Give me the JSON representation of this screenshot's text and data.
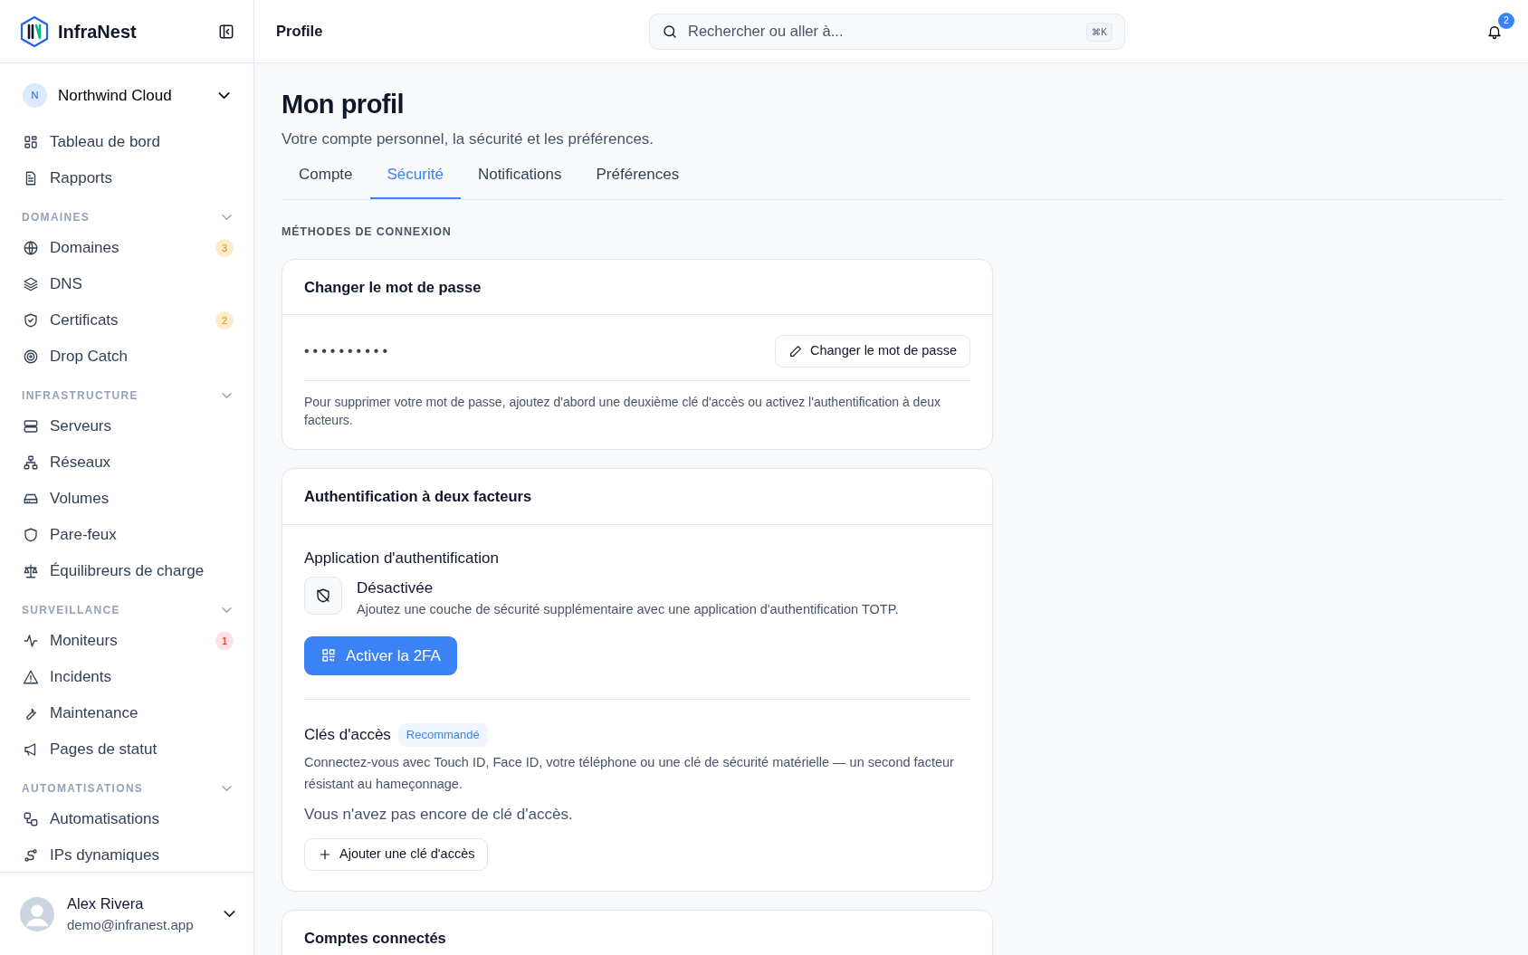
{
  "sidebar": {
    "brand": "InfraNest",
    "org": {
      "initial": "N",
      "name": "Northwind Cloud"
    },
    "top_items": [
      {
        "label": "Tableau de bord"
      },
      {
        "label": "Rapports"
      }
    ],
    "sections": [
      {
        "title": "DOMAINES",
        "items": [
          {
            "label": "Domaines",
            "badge": "3",
            "color": "#fdeccc"
          },
          {
            "label": "DNS"
          },
          {
            "label": "Certificats",
            "badge": "2",
            "color": "#fdeccc"
          },
          {
            "label": "Drop Catch"
          }
        ]
      },
      {
        "title": "INFRASTRUCTURE",
        "items": [
          {
            "label": "Serveurs"
          },
          {
            "label": "Réseaux"
          },
          {
            "label": "Volumes"
          },
          {
            "label": "Pare-feux"
          },
          {
            "label": "Équilibreurs de charge"
          }
        ]
      },
      {
        "title": "SURVEILLANCE",
        "items": [
          {
            "label": "Moniteurs",
            "badge": "1",
            "color": "#fde2e2"
          },
          {
            "label": "Incidents"
          },
          {
            "label": "Maintenance"
          },
          {
            "label": "Pages de statut"
          }
        ]
      },
      {
        "title": "AUTOMATISATIONS",
        "items": [
          {
            "label": "Automatisations"
          },
          {
            "label": "IPs dynamiques"
          }
        ]
      }
    ],
    "user": {
      "name": "Alex Rivera",
      "email": "demo@infranest.app"
    }
  },
  "header": {
    "title": "Profile",
    "search": {
      "placeholder": "Rechercher ou aller à...",
      "shortcut": "⌘K"
    },
    "notifications": "2"
  },
  "page": {
    "title": "Mon profil",
    "subtitle": "Votre compte personnel, la sécurité et les préférences.",
    "tabs": [
      {
        "label": "Compte",
        "selected": false
      },
      {
        "label": "Sécurité",
        "selected": true
      },
      {
        "label": "Notifications",
        "selected": false
      },
      {
        "label": "Préférences",
        "selected": false
      }
    ],
    "section_label": "MÉTHODES DE CONNEXION",
    "password_card": {
      "title": "Changer le mot de passe",
      "masked": "••••••••••",
      "button": "Changer le mot de passe",
      "note": "Pour supprimer votre mot de passe, ajoutez d'abord une deuxième clé d'accès ou activez l'authentification à deux facteurs."
    },
    "twofa_card": {
      "title": "Authentification à deux facteurs",
      "app_title": "Application d'authentification",
      "status": "Désactivée",
      "status_desc": "Ajoutez une couche de sécurité supplémentaire avec une application d'authentification TOTP.",
      "button": "Activer la 2FA",
      "passkeys_title": "Clés d'accès",
      "passkeys_badge": "Recommandé",
      "passkeys_desc": "Connectez-vous avec Touch ID, Face ID, votre téléphone ou une clé de sécurité matérielle — un second facteur résistant au hameçonnage.",
      "empty": "Vous n'avez pas encore de clé d'accès.",
      "add_button": "Ajouter une clé d'accès"
    },
    "connected_card": {
      "title": "Comptes connectés"
    }
  }
}
